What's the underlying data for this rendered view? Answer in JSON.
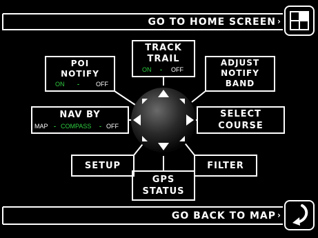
{
  "top_bar": {
    "label": "GO TO HOME SCREEN"
  },
  "bottom_bar": {
    "label": "GO BACK TO MAP"
  },
  "menu": {
    "track_trail": {
      "title_line1": "TRACK",
      "title_line2": "TRAIL",
      "on": "ON",
      "sep": "-",
      "off": "OFF"
    },
    "poi_notify": {
      "title_line1": "POI",
      "title_line2": "NOTIFY",
      "on": "ON",
      "sep": "-",
      "off": "OFF"
    },
    "adjust_notify_band": {
      "line1": "ADJUST",
      "line2": "NOTIFY",
      "line3": "BAND"
    },
    "nav_by": {
      "title": "NAV BY",
      "opt1": "MAP",
      "opt2": "COMPASS",
      "opt3": "OFF",
      "sep": "-"
    },
    "select_course": {
      "line1": "SELECT",
      "line2": "COURSE"
    },
    "setup": {
      "label": "SETUP"
    },
    "gps_status": {
      "line1": "GPS",
      "line2": "STATUS"
    },
    "filter": {
      "label": "FILTER"
    }
  },
  "icons": {
    "home": "home-grid-icon",
    "back": "back-arrow-icon",
    "dpad": "dpad-joystick-icon"
  },
  "colors": {
    "background": "#000000",
    "foreground": "#ffffff",
    "on_state": "#2ecc40"
  }
}
